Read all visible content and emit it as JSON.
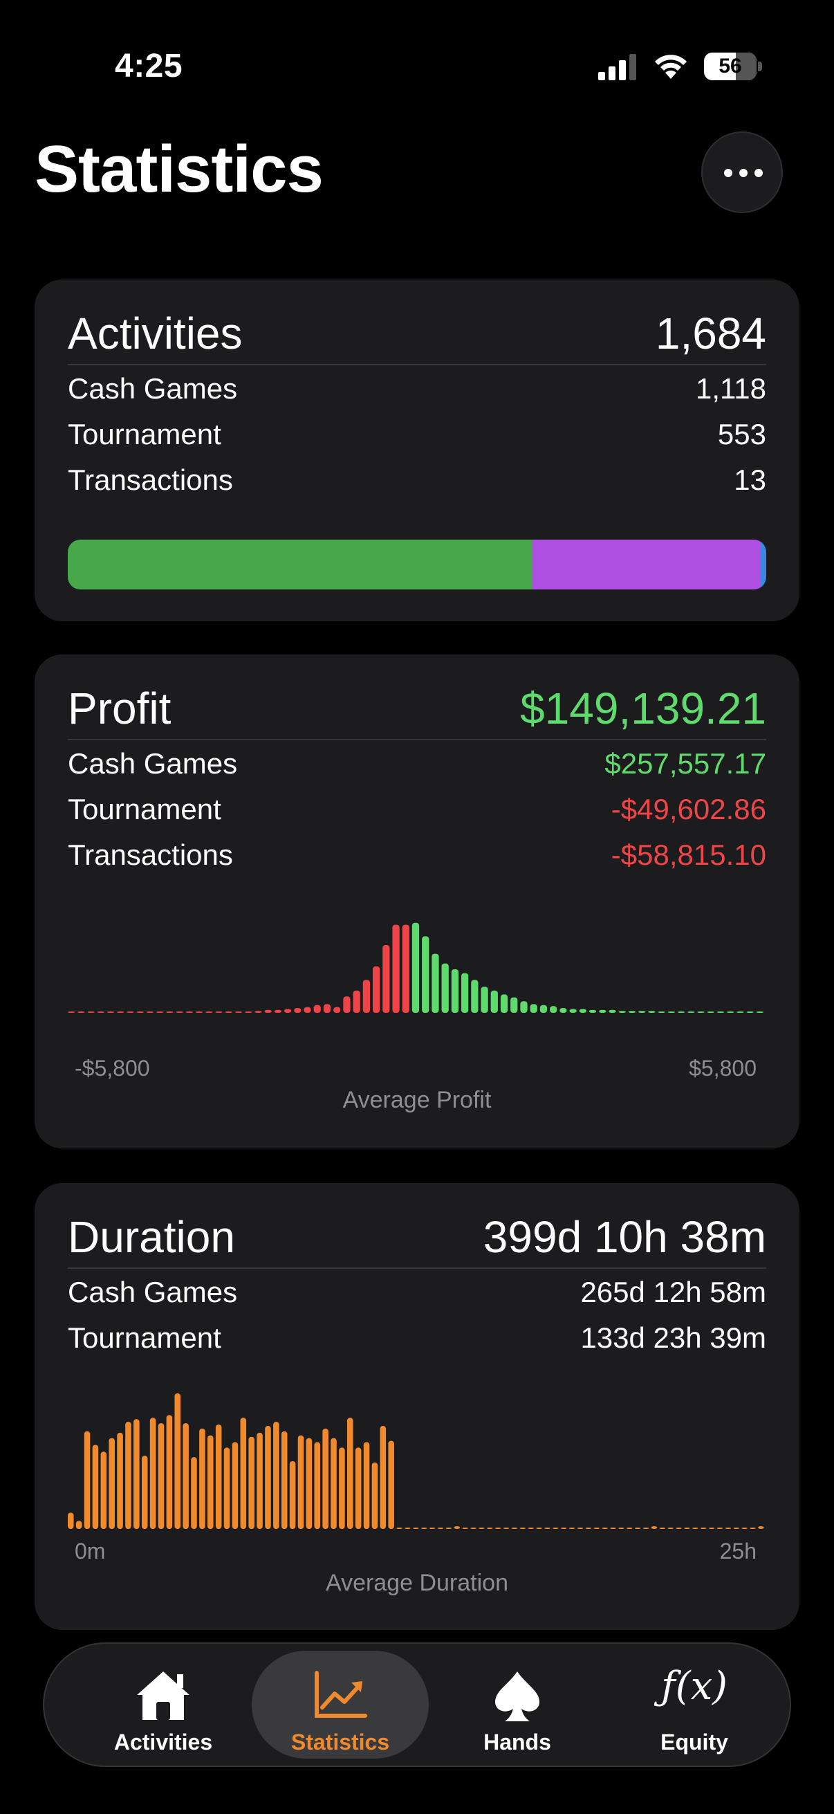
{
  "status_bar": {
    "time": "4:25",
    "battery": "56"
  },
  "header": {
    "title": "Statistics",
    "more_icon": "ellipsis-icon"
  },
  "activities": {
    "title": "Activities",
    "total": "1,684",
    "rows": [
      {
        "label": "Cash Games",
        "value": "1,118"
      },
      {
        "label": "Tournament",
        "value": "553"
      },
      {
        "label": "Transactions",
        "value": "13"
      }
    ],
    "bar": [
      {
        "name": "Cash Games",
        "count": 1118,
        "color": "#46a84a"
      },
      {
        "name": "Tournament",
        "count": 553,
        "color": "#b050e2"
      },
      {
        "name": "Transactions",
        "count": 13,
        "color": "#3e86e0"
      }
    ]
  },
  "profit": {
    "title": "Profit",
    "total": "$149,139.21",
    "rows": [
      {
        "label": "Cash Games",
        "value": "$257,557.17",
        "tone": "positive"
      },
      {
        "label": "Tournament",
        "value": "-$49,602.86",
        "tone": "negative"
      },
      {
        "label": "Transactions",
        "value": "-$58,815.10",
        "tone": "negative"
      }
    ],
    "axis_min": "-$5,800",
    "axis_max": "$5,800",
    "caption": "Average Profit"
  },
  "duration": {
    "title": "Duration",
    "total": "399d 10h 38m",
    "rows": [
      {
        "label": "Cash Games",
        "value": "265d 12h 58m"
      },
      {
        "label": "Tournament",
        "value": "133d 23h 39m"
      }
    ],
    "axis_min": "0m",
    "axis_max": "25h",
    "caption": "Average Duration"
  },
  "tabs": [
    {
      "label": "Activities",
      "icon": "house-icon",
      "active": false
    },
    {
      "label": "Statistics",
      "icon": "chart-up-icon",
      "active": true
    },
    {
      "label": "Hands",
      "icon": "spade-icon",
      "active": false
    },
    {
      "label": "Equity",
      "icon": "function-icon",
      "active": false
    }
  ],
  "colors": {
    "positive": "#5fdb6e",
    "negative": "#ef4548",
    "accent": "#f08a2c",
    "card": "#1c1c1e"
  },
  "chart_data": [
    {
      "type": "bar",
      "title": "",
      "xlabel": "Average Profit",
      "ylabel": "",
      "x_range_labels": [
        "-$5,800",
        "$5,800"
      ],
      "bins_negative_relative_heights": [
        0.01,
        0.01,
        0,
        0.01,
        0,
        0,
        0.01,
        0,
        0,
        0,
        0,
        0.01,
        0,
        0,
        0,
        0,
        0,
        0.01,
        0.01,
        0.02,
        0.03,
        0.03,
        0.04,
        0.05,
        0.06,
        0.08,
        0.09,
        0.06,
        0.17,
        0.23,
        0.34,
        0.48,
        0.7,
        0.91,
        0.91
      ],
      "bins_positive_relative_heights": [
        0.93,
        0.79,
        0.61,
        0.51,
        0.45,
        0.41,
        0.34,
        0.27,
        0.23,
        0.19,
        0.16,
        0.12,
        0.09,
        0.08,
        0.07,
        0.05,
        0.04,
        0.04,
        0.03,
        0.03,
        0.03,
        0.02,
        0.02,
        0.02,
        0.02,
        0.01,
        0.01,
        0.01,
        0.01,
        0,
        0.01,
        0,
        0.01,
        0.01,
        0.01,
        0.01
      ],
      "colors": {
        "negative": "#ef4548",
        "positive": "#5fdb6e"
      }
    },
    {
      "type": "bar",
      "title": "",
      "xlabel": "Average Duration",
      "ylabel": "",
      "x_range_labels": [
        "0m",
        "25h"
      ],
      "bins_relative_heights": [
        0.12,
        0.06,
        0.72,
        0.62,
        0.57,
        0.67,
        0.71,
        0.79,
        0.81,
        0.54,
        0.82,
        0.78,
        0.84,
        1.0,
        0.78,
        0.53,
        0.74,
        0.69,
        0.77,
        0.6,
        0.64,
        0.82,
        0.68,
        0.71,
        0.76,
        0.79,
        0.72,
        0.5,
        0.69,
        0.67,
        0.64,
        0.74,
        0.67,
        0.6,
        0.82,
        0.6,
        0.64,
        0.49,
        0.76,
        0.65,
        0,
        0,
        0,
        0,
        0,
        0,
        0,
        0.02,
        0,
        0,
        0,
        0,
        0,
        0,
        0,
        0,
        0,
        0,
        0,
        0,
        0,
        0,
        0,
        0,
        0,
        0,
        0,
        0,
        0,
        0,
        0,
        0.02,
        0,
        0,
        0,
        0,
        0,
        0,
        0,
        0,
        0,
        0,
        0,
        0,
        0.02
      ],
      "color": "#f08a2c"
    }
  ]
}
